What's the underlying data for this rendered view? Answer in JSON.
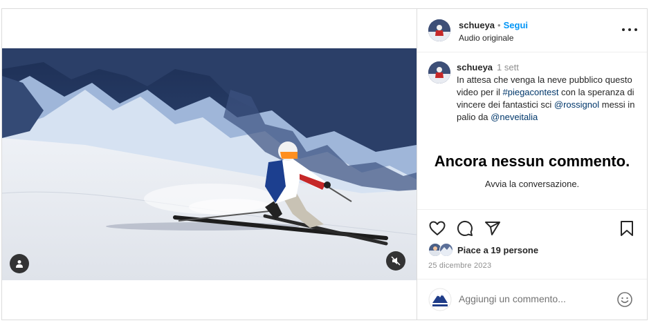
{
  "post": {
    "username": "schueya",
    "follow_label": "Segui",
    "audio_label": "Audio originale",
    "caption": {
      "username": "schueya",
      "time": "1 sett",
      "text_1": "In attesa che venga la neve pubblico questo video per il ",
      "hashtag": "#piegacontest",
      "text_2": " con la speranza di vincere dei fantastici sci ",
      "mention_1": "@rossignol",
      "text_3": " messi in palio da ",
      "mention_2": "@neveitalia"
    },
    "empty_comments": {
      "title": "Ancora nessun commento.",
      "subtitle": "Avvia la conversazione."
    },
    "likes_text": "Piace a 19 persone",
    "date": "25 dicembre 2023",
    "comment_placeholder": "Aggiungi un commento...",
    "icons": {
      "more": "more-options-icon",
      "like": "heart-icon",
      "comment": "comment-icon",
      "share": "paper-plane-icon",
      "save": "bookmark-icon",
      "emoji": "emoji-icon",
      "mute": "audio-muted-icon",
      "user_tags": "user-tag-icon"
    },
    "colors": {
      "accent": "#0095f6",
      "link": "#00376b",
      "muted_text": "#8e8e8e",
      "border": "#dbdbdb"
    }
  }
}
